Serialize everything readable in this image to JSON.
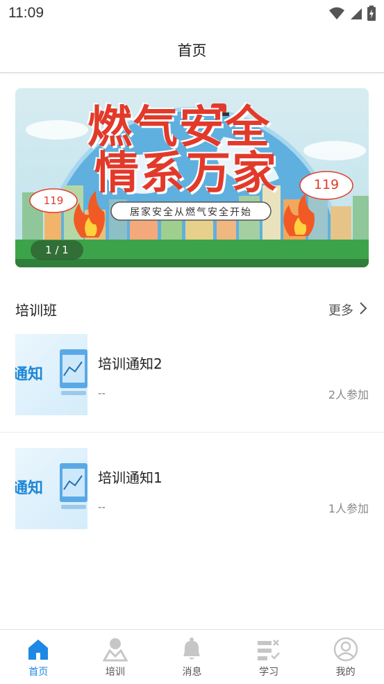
{
  "status_bar": {
    "time": "11:09"
  },
  "header": {
    "title": "首页"
  },
  "banner": {
    "headline_line1": "燃气安全",
    "headline_line2": "情系万家",
    "slogan": "居家安全从燃气安全开始",
    "emergency_number": "119",
    "counter": "1 / 1"
  },
  "section": {
    "title": "培训班",
    "more_label": "更多"
  },
  "courses": [
    {
      "thumb_text": "通知",
      "name": "培训通知2",
      "desc": "--",
      "count": "2人参加"
    },
    {
      "thumb_text": "通知",
      "name": "培训通知1",
      "desc": "--",
      "count": "1人参加"
    }
  ],
  "tabs": [
    {
      "label": "首页",
      "icon": "home-icon",
      "active": true
    },
    {
      "label": "培训",
      "icon": "training-icon",
      "active": false
    },
    {
      "label": "消息",
      "icon": "bell-icon",
      "active": false
    },
    {
      "label": "学习",
      "icon": "study-icon",
      "active": false
    },
    {
      "label": "我的",
      "icon": "profile-icon",
      "active": false
    }
  ],
  "colors": {
    "accent": "#1e88e5",
    "inactive_icon": "#c6c6c6",
    "banner_red": "#e23a2a"
  }
}
